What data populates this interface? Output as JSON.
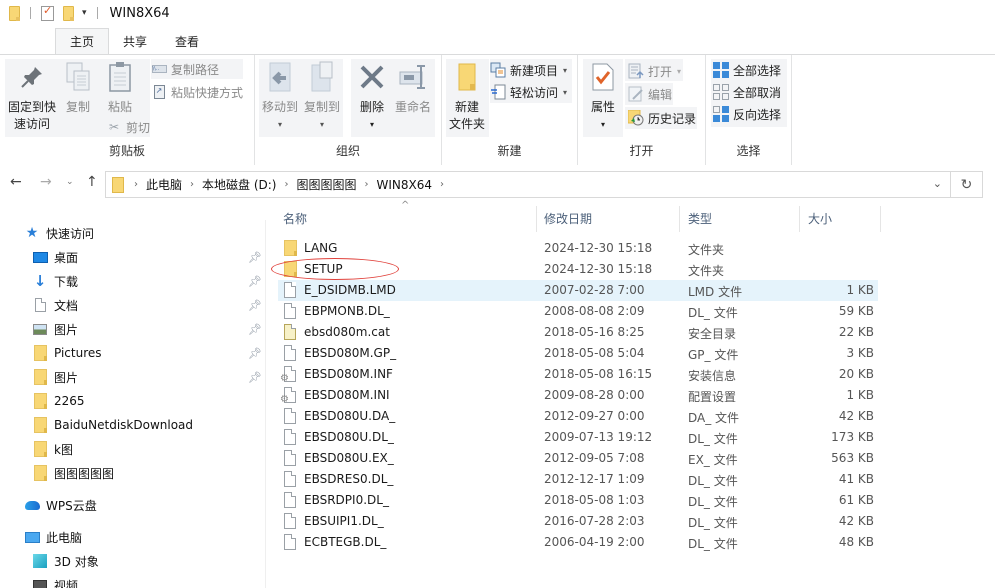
{
  "window": {
    "title": "WIN8X64"
  },
  "tabs": [
    {
      "label": "主页",
      "active": true
    },
    {
      "label": "共享",
      "active": false
    },
    {
      "label": "查看",
      "active": false
    }
  ],
  "ribbon": {
    "clipboard": {
      "label": "剪贴板",
      "pin_label_1": "固定到快",
      "pin_label_2": "速访问",
      "copy": "复制",
      "paste": "粘贴",
      "copy_path": "复制路径",
      "paste_shortcut": "粘贴快捷方式",
      "cut": "剪切"
    },
    "organize": {
      "label": "组织",
      "move_to": "移动到",
      "copy_to": "复制到",
      "delete": "删除",
      "rename": "重命名"
    },
    "new": {
      "label": "新建",
      "new_folder_1": "新建",
      "new_folder_2": "文件夹",
      "new_item": "新建项目",
      "easy_access": "轻松访问"
    },
    "open": {
      "label": "打开",
      "properties": "属性",
      "open": "打开",
      "edit": "编辑",
      "history": "历史记录"
    },
    "select": {
      "label": "选择",
      "select_all": "全部选择",
      "select_none": "全部取消",
      "invert": "反向选择"
    }
  },
  "address": {
    "crumbs": [
      "此电脑",
      "本地磁盘 (D:)",
      "图图图图图",
      "WIN8X64"
    ]
  },
  "sidebar": {
    "quick_access": "快速访问",
    "items": [
      {
        "label": "桌面",
        "icon": "desktop-icon",
        "pinned": true
      },
      {
        "label": "下载",
        "icon": "download-icon",
        "pinned": true
      },
      {
        "label": "文档",
        "icon": "document-icon",
        "pinned": true
      },
      {
        "label": "图片",
        "icon": "pictures-icon",
        "pinned": true
      },
      {
        "label": "Pictures",
        "icon": "folder-icon",
        "pinned": true
      },
      {
        "label": "图片",
        "icon": "folder-icon",
        "pinned": true
      },
      {
        "label": "2265",
        "icon": "folder-icon",
        "pinned": false
      },
      {
        "label": "BaiduNetdiskDownload",
        "icon": "folder-icon",
        "pinned": false
      },
      {
        "label": "k图",
        "icon": "folder-icon",
        "pinned": false
      },
      {
        "label": "图图图图图",
        "icon": "folder-icon",
        "pinned": false
      }
    ],
    "wps": "WPS云盘",
    "this_pc": "此电脑",
    "pc_items": [
      {
        "label": "3D 对象",
        "icon": "3d-objects-icon"
      },
      {
        "label": "视频",
        "icon": "videos-icon"
      }
    ]
  },
  "list": {
    "columns": {
      "name": "名称",
      "date": "修改日期",
      "type": "类型",
      "size": "大小"
    },
    "rows": [
      {
        "name": "LANG",
        "date": "2024-12-30 15:18",
        "type": "文件夹",
        "size": "",
        "icon": "folder"
      },
      {
        "name": "SETUP",
        "date": "2024-12-30 15:18",
        "type": "文件夹",
        "size": "",
        "icon": "folder",
        "circled": true
      },
      {
        "name": "E_DSIDMB.LMD",
        "date": "2007-02-28 7:00",
        "type": "LMD 文件",
        "size": "1 KB",
        "icon": "file",
        "selected": true
      },
      {
        "name": "EBPMONB.DL_",
        "date": "2008-08-08 2:09",
        "type": "DL_ 文件",
        "size": "59 KB",
        "icon": "file"
      },
      {
        "name": "ebsd080m.cat",
        "date": "2018-05-16 8:25",
        "type": "安全目录",
        "size": "22 KB",
        "icon": "cat"
      },
      {
        "name": "EBSD080M.GP_",
        "date": "2018-05-08 5:04",
        "type": "GP_ 文件",
        "size": "3 KB",
        "icon": "file"
      },
      {
        "name": "EBSD080M.INF",
        "date": "2018-05-08 16:15",
        "type": "安装信息",
        "size": "20 KB",
        "icon": "settings"
      },
      {
        "name": "EBSD080M.INI",
        "date": "2009-08-28 0:00",
        "type": "配置设置",
        "size": "1 KB",
        "icon": "settings"
      },
      {
        "name": "EBSD080U.DA_",
        "date": "2012-09-27 0:00",
        "type": "DA_ 文件",
        "size": "42 KB",
        "icon": "file"
      },
      {
        "name": "EBSD080U.DL_",
        "date": "2009-07-13 19:12",
        "type": "DL_ 文件",
        "size": "173 KB",
        "icon": "file"
      },
      {
        "name": "EBSD080U.EX_",
        "date": "2012-09-05 7:08",
        "type": "EX_ 文件",
        "size": "563 KB",
        "icon": "file"
      },
      {
        "name": "EBSDRES0.DL_",
        "date": "2012-12-17 1:09",
        "type": "DL_ 文件",
        "size": "41 KB",
        "icon": "file"
      },
      {
        "name": "EBSRDPI0.DL_",
        "date": "2018-05-08 1:03",
        "type": "DL_ 文件",
        "size": "61 KB",
        "icon": "file"
      },
      {
        "name": "EBSUIPI1.DL_",
        "date": "2016-07-28 2:03",
        "type": "DL_ 文件",
        "size": "42 KB",
        "icon": "file"
      },
      {
        "name": "ECBTEGB.DL_",
        "date": "2006-04-19 2:00",
        "type": "DL_ 文件",
        "size": "48 KB",
        "icon": "file"
      }
    ]
  },
  "colors": {
    "selection": "#e5f3fb",
    "folder": "#f8d775",
    "annotation": "#e0403a",
    "accent": "#1e88e5"
  }
}
